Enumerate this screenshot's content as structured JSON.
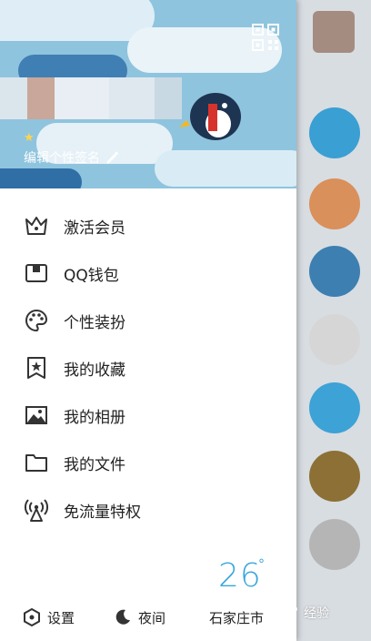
{
  "header": {
    "signature_text": "编辑个性签名"
  },
  "menu": {
    "items": [
      {
        "label": "激活会员",
        "icon": "crown-icon"
      },
      {
        "label": "QQ钱包",
        "icon": "wallet-icon"
      },
      {
        "label": "个性装扮",
        "icon": "palette-icon"
      },
      {
        "label": "我的收藏",
        "icon": "bookmark-star-icon"
      },
      {
        "label": "我的相册",
        "icon": "photo-icon"
      },
      {
        "label": "我的文件",
        "icon": "folder-icon"
      },
      {
        "label": "免流量特权",
        "icon": "antenna-icon"
      }
    ]
  },
  "weather": {
    "temperature": "26",
    "degree_symbol": "°",
    "city": "石家庄市"
  },
  "bottom": {
    "settings_label": "设置",
    "night_label": "夜间"
  },
  "watermark": {
    "text": "经验"
  },
  "colors": {
    "accent": "#3aa7dd",
    "header_bg": "#8fc4de"
  }
}
